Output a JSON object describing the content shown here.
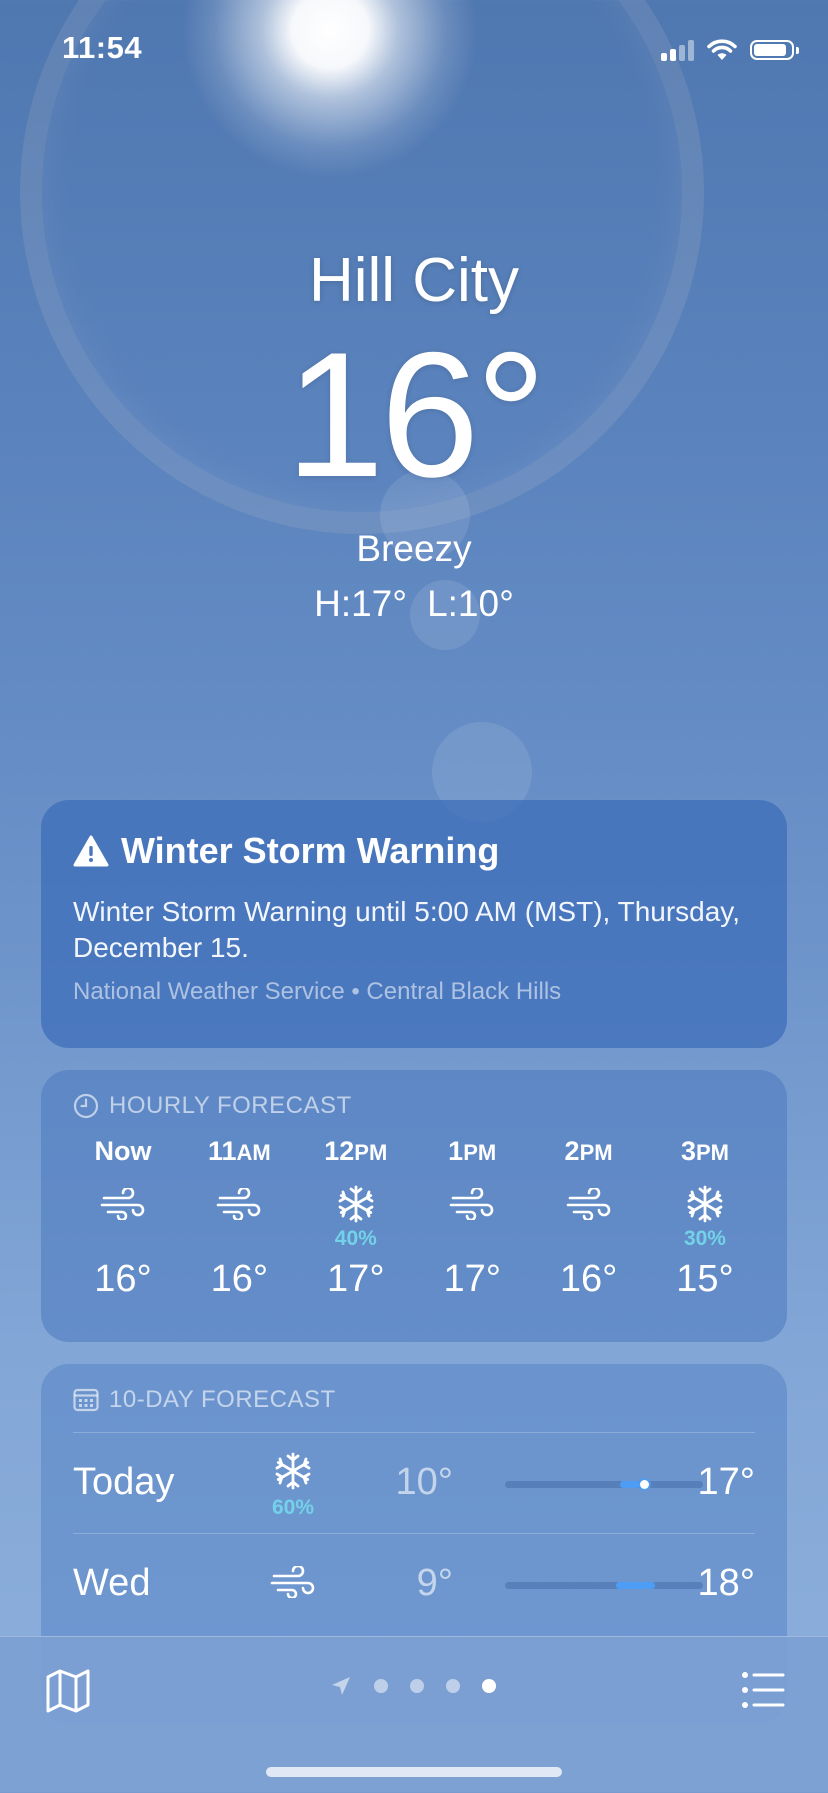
{
  "status_bar": {
    "time": "11:54"
  },
  "location": {
    "city": "Hill City",
    "temperature": "16°",
    "condition": "Breezy",
    "high": "H:17°",
    "low": "L:10°"
  },
  "alert": {
    "title": "Winter Storm Warning",
    "body": "Winter Storm Warning until 5:00 AM (MST), Thursday, December 15.",
    "source": "National Weather Service • Central Black Hills"
  },
  "hourly": {
    "title": "HOURLY FORECAST",
    "items": [
      {
        "label": "Now",
        "suffix": "",
        "icon": "wind-icon",
        "pop": "",
        "temp": "16°"
      },
      {
        "label": "11",
        "suffix": "AM",
        "icon": "wind-icon",
        "pop": "",
        "temp": "16°"
      },
      {
        "label": "12",
        "suffix": "PM",
        "icon": "snowflake-icon",
        "pop": "40%",
        "temp": "17°"
      },
      {
        "label": "1",
        "suffix": "PM",
        "icon": "wind-icon",
        "pop": "",
        "temp": "17°"
      },
      {
        "label": "2",
        "suffix": "PM",
        "icon": "wind-icon",
        "pop": "",
        "temp": "16°"
      },
      {
        "label": "3",
        "suffix": "PM",
        "icon": "snowflake-icon",
        "pop": "30%",
        "temp": "15°"
      }
    ]
  },
  "ten_day": {
    "title": "10-DAY FORECAST",
    "days": [
      {
        "day": "Today",
        "icon": "snowflake-icon",
        "pop": "60%",
        "low": "10°",
        "high": "17°",
        "range_start": 0.58,
        "range_end": 0.68,
        "current": 0.7
      },
      {
        "day": "Wed",
        "icon": "wind-icon",
        "pop": "",
        "low": "9°",
        "high": "18°",
        "range_start": 0.56,
        "range_end": 0.76,
        "current": null
      }
    ]
  },
  "toolbar": {
    "page_count": 4,
    "active_page": 4
  },
  "colors": {
    "accent": "#4d9df5",
    "precip": "#74d2e8"
  }
}
